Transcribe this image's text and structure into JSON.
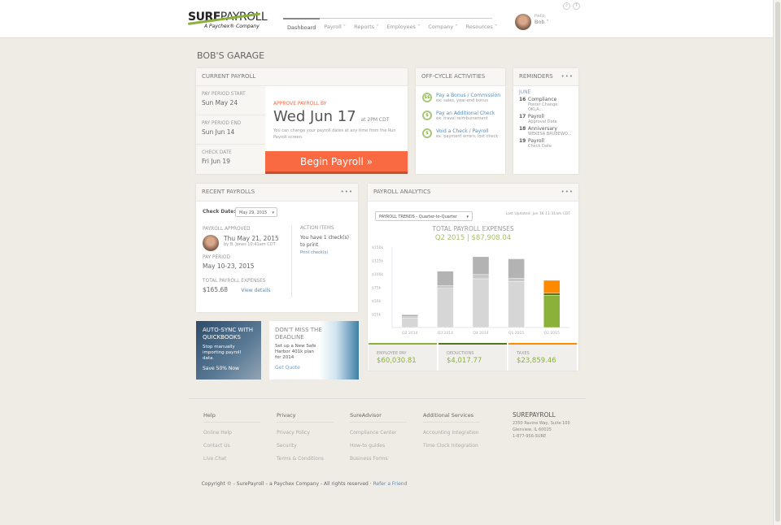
{
  "header": {
    "logo_text_bold": "SURE",
    "logo_text": "PAYROLL",
    "logo_sub": "A Paychex® Company",
    "nav": [
      "Dashboard",
      "Payroll",
      "Reports",
      "Employees",
      "Company",
      "Resources"
    ],
    "greeting": "Hello,",
    "user": "Bob",
    "search_icon": "search-icon",
    "help_icon": "?"
  },
  "business_name": "BOB'S GARAGE",
  "current_payroll": {
    "title": "CURRENT PAYROLL",
    "fields": [
      {
        "label": "PAY PERIOD START",
        "value": "Sun May 24"
      },
      {
        "label": "PAY PERIOD END",
        "value": "Sun Jun 14"
      },
      {
        "label": "CHECK DATE",
        "value": "Fri Jun 19"
      }
    ],
    "approve_label": "APPROVE PAYROLL BY",
    "approve_date": "Wed Jun 17",
    "approve_time": "at 2PM CDT",
    "note": "You can change your payroll dates at any time from the Run Payroll screen.",
    "button": "Begin Payroll »",
    "accent": "#f96a43"
  },
  "off_cycle": {
    "title": "OFF-CYCLE ACTIVITIES",
    "items": [
      {
        "icon": "$$",
        "label": "Pay a Bonus / Commission",
        "desc": "ex: sales, year-end bonus"
      },
      {
        "icon": "$",
        "label": "Pay an Additional Check",
        "desc": "ex: travel reimbursement"
      },
      {
        "icon": "$",
        "label": "Void a Check / Payroll",
        "desc": "ex: payment errors, lost check"
      }
    ]
  },
  "reminders": {
    "title": "REMINDERS",
    "month": "JUNE",
    "items": [
      {
        "day": "16",
        "title": "Compliance",
        "sub": "Poster Change: OKLA..."
      },
      {
        "day": "17",
        "title": "Payroll",
        "sub": "Approval Date"
      },
      {
        "day": "18",
        "title": "Anniversary",
        "sub": "WEKESA BRUBEWO..."
      },
      {
        "day": "19",
        "title": "Payroll",
        "sub": "Check Date"
      }
    ]
  },
  "recent": {
    "title": "RECENT PAYROLLS",
    "check_date_label": "Check Date:",
    "check_date": "May 29, 2015",
    "approved_label": "PAYROLL APPROVED",
    "approved_date": "Thu May 21, 2015",
    "approved_by": "by B. Jones 10:41am CDT",
    "period_label": "PAY PERIOD",
    "period": "May 10-23, 2015",
    "total_label": "TOTAL PAYROLL EXPENSES",
    "total": "$165.68",
    "view": "View details",
    "action_label": "ACTION ITEMS",
    "action_text": "You have 1 check(s) to print.",
    "action_link": "Print check(s)"
  },
  "analytics": {
    "title": "PAYROLL ANALYTICS",
    "select": "PAYROLL TRENDS - Quarter-to-Quarter",
    "updated": "Last Updated: Jun 16 11:31am CDT",
    "chart_title": "TOTAL PAYROLL EXPENSES",
    "chart_sub": "Q2 2015 | $87,908.04",
    "stats": [
      {
        "label": "EMPLOYEE PAY",
        "value": "$60,030.81",
        "color": "#8bb13a"
      },
      {
        "label": "DEDUCTIONS",
        "value": "$4,017.77",
        "color": "#4f7a1e"
      },
      {
        "label": "TAXES",
        "value": "$23,859.46",
        "color": "#ff8a00"
      }
    ]
  },
  "chart_data": {
    "type": "bar",
    "stacked": true,
    "categories": [
      "Q2 2014",
      "Q3 2014",
      "Q4 2014",
      "Q1 2015",
      "Q2 2015"
    ],
    "yticks": [
      "$25k",
      "$50k",
      "$75k",
      "$100k",
      "$125k",
      "$150k"
    ],
    "ylim": [
      0,
      150000
    ],
    "series": [
      {
        "name": "EMPLOYEE PAY",
        "values": [
          18000,
          73000,
          91000,
          86000,
          60030.81
        ]
      },
      {
        "name": "DEDUCTIONS",
        "values": [
          2000,
          5000,
          8000,
          6000,
          4017.77
        ]
      },
      {
        "name": "TAXES",
        "values": [
          4000,
          27000,
          33000,
          36000,
          23859.46
        ]
      }
    ],
    "colors_past": [
      "#d6d6d6",
      "#c8c8c8",
      "#b3b3b3"
    ],
    "colors_current": [
      "#8bb13a",
      "#4f7a1e",
      "#ff8a00"
    ]
  },
  "ads": [
    {
      "title": "AUTO-SYNC WITH QUICKBOOKS",
      "text": "Stop manually importing payroll data.",
      "cta": "Save 50% Now"
    },
    {
      "title": "DON'T MISS THE DEADLINE",
      "text": "Set up a New Safe Harbor 401k plan for 2014",
      "cta": "Get Quote"
    }
  ],
  "footer": {
    "cols": [
      {
        "h": "Help",
        "links": [
          "Online Help",
          "Contact Us",
          "Live Chat"
        ]
      },
      {
        "h": "Privacy",
        "links": [
          "Privacy Policy",
          "Security",
          "Terms & Conditions"
        ]
      },
      {
        "h": "SureAdvisor",
        "links": [
          "Compliance Center",
          "How-to guides",
          "Business Forms"
        ]
      },
      {
        "h": "Additional Services",
        "links": [
          "Accounting Integration",
          "Time Clock Integration"
        ]
      }
    ],
    "company": "SUREPAYROLL",
    "address1": "2350 Ravine Way, Suite 100",
    "address2": "Glenview, IL 60025",
    "phone": "1-877-956-SURE",
    "copyright": "Copyright © - SurePayroll – a Paychex Company - All rights reserved ·",
    "refer": "Refer a Friend"
  }
}
